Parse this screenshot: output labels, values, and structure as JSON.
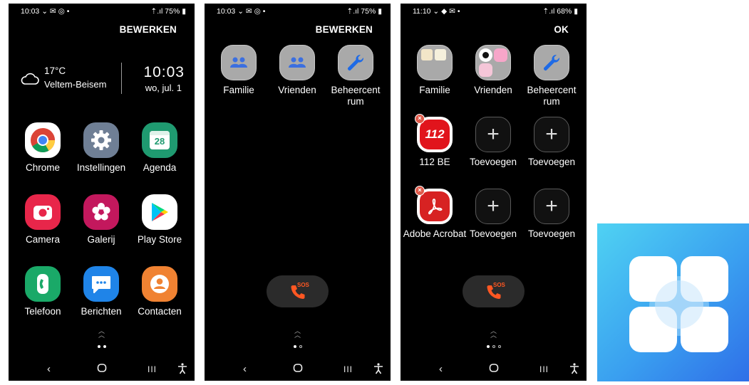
{
  "screens": [
    {
      "status": {
        "time": "10:03 ⌄ ✉ ◎ •",
        "right": "⇡.ıl 75% ▮"
      },
      "top_action": "BEWERKEN",
      "weather": {
        "temp": "17°C",
        "place": "Veltem-Beisem",
        "time": "10:03",
        "date": "wo, jul. 1"
      },
      "apps": [
        "Chrome",
        "Instellingen",
        "Agenda",
        "Camera",
        "Galerij",
        "Play Store",
        "Telefoon",
        "Berichten",
        "Contacten"
      ],
      "agenda_day": "28"
    },
    {
      "status": {
        "time": "10:03 ⌄ ✉ ◎ •",
        "right": "⇡.ıl 75% ▮"
      },
      "top_action": "BEWERKEN",
      "apps": [
        "Familie",
        "Vrienden",
        "Beheercent rum"
      ],
      "sos": "SOS"
    },
    {
      "status": {
        "time": "11:10 ⌄ ◆ ✉ •",
        "right": "⇡.ıl 68% ▮"
      },
      "top_action": "OK",
      "apps": [
        "Familie",
        "Vrienden",
        "Beheercent rum",
        "112 BE",
        "Toevoegen",
        "Toevoegen",
        "Adobe Acrobat",
        "Toevoegen",
        "Toevoegen"
      ],
      "badge_112": "112",
      "sos": "SOS"
    }
  ],
  "colors": {
    "background": "#000000",
    "folder": "#a9a9a9",
    "people_icon": "#3b6fe0",
    "wrench_icon": "#1e6ae6",
    "sos_phone": "#ff5722",
    "red_112": "#e1141c",
    "acrobat": "#d72222",
    "logo_gradient": [
      "#4fd2f3",
      "#2f6fe8"
    ]
  },
  "icons": [
    "cloud-icon",
    "people-icon",
    "wrench-icon",
    "plus-icon",
    "phone-sos-icon",
    "back-icon",
    "home-icon",
    "recents-icon",
    "accessibility-icon",
    "remove-badge-icon"
  ]
}
